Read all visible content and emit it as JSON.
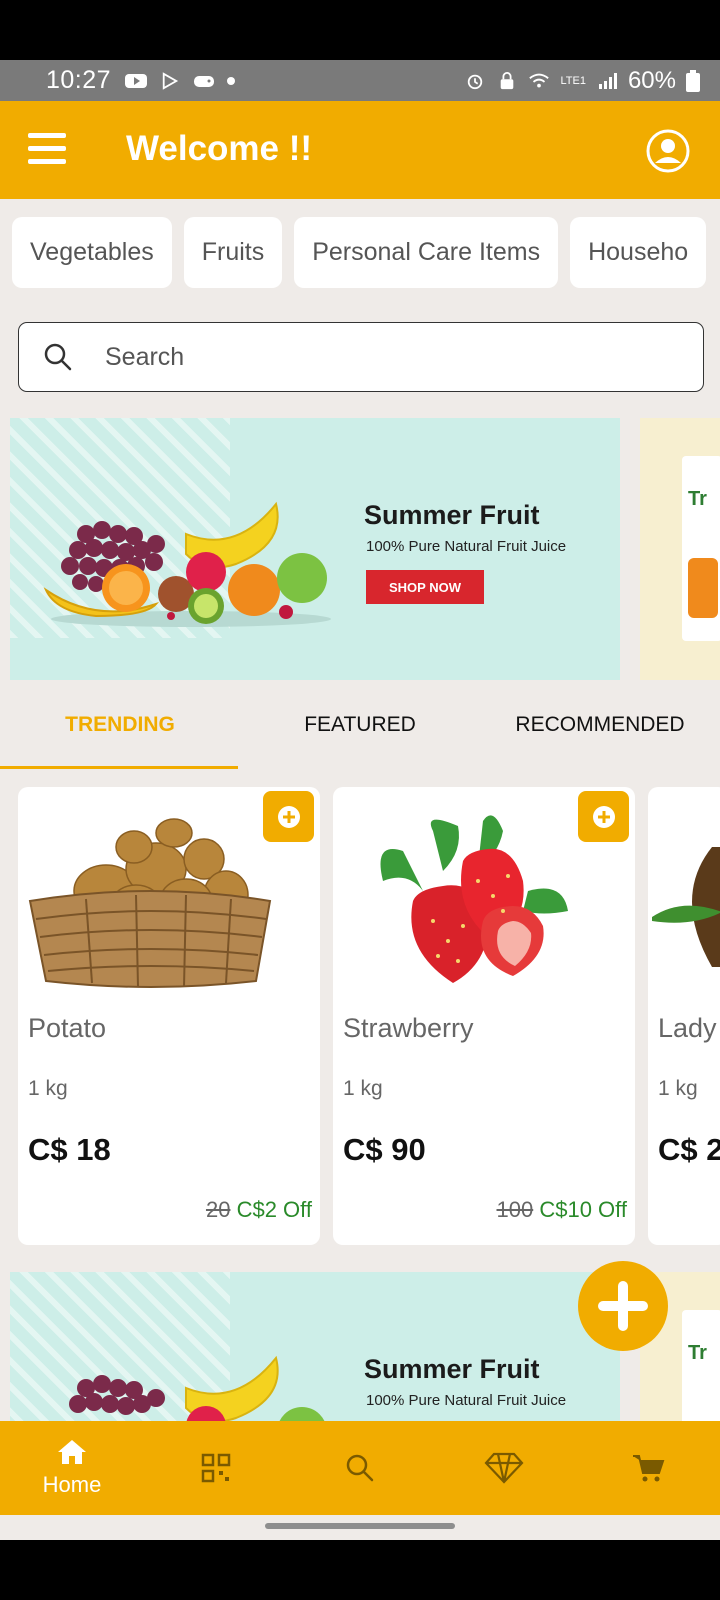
{
  "status_bar": {
    "time": "10:27",
    "battery": "60%",
    "network": "LTE1"
  },
  "header": {
    "title": "Welcome !!"
  },
  "categories": [
    "Vegetables",
    "Fruits",
    "Personal Care Items",
    "Househo"
  ],
  "search": {
    "placeholder": "Search"
  },
  "banners": [
    {
      "title": "Summer Fruit",
      "subtitle": "100% Pure Natural Fruit Juice",
      "button": "SHOP NOW"
    },
    {
      "title": "Summer Fruit",
      "subtitle": "100% Pure Natural Fruit Juice"
    }
  ],
  "side_banner_text": "Tr",
  "tabs": [
    "TRENDING",
    "FEATURED",
    "RECOMMENDED"
  ],
  "active_tab": "TRENDING",
  "products": [
    {
      "name": "Potato",
      "qty": "1 kg",
      "price": "C$ 18",
      "old_price": "20",
      "discount": "C$2 Off"
    },
    {
      "name": "Strawberry",
      "qty": "1 kg",
      "price": "C$ 90",
      "old_price": "100",
      "discount": "C$10 Off"
    },
    {
      "name": "Lady",
      "qty": "1 kg",
      "price": "C$ 2"
    }
  ],
  "bottom_nav": {
    "home_label": "Home"
  },
  "colors": {
    "accent": "#f1ac00",
    "background": "#efebe8",
    "banner": "#cdeee8",
    "discount": "#2a8a2a",
    "shop_button": "#d8262d"
  }
}
